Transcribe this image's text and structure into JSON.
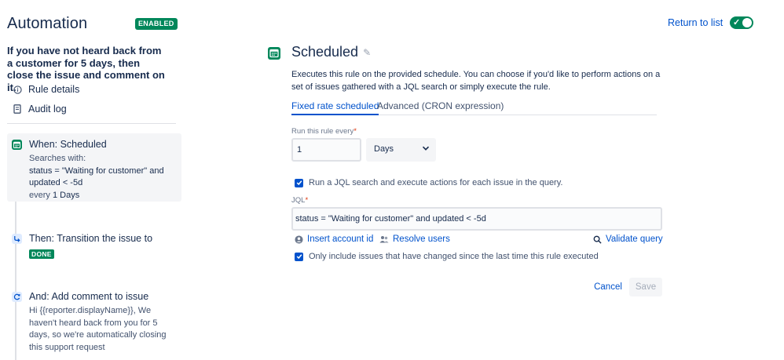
{
  "header": {
    "title": "Automation",
    "status_badge": "ENABLED",
    "return_link": "Return to list",
    "toggle_on": true,
    "toggle_color": "#00875a"
  },
  "sidebar": {
    "rule_description": "If you have not heard back from a customer for 5 days, then close the issue and comment on it.",
    "links": [
      {
        "label": "Rule details",
        "icon": "info-icon"
      },
      {
        "label": "Audit log",
        "icon": "document-icon"
      }
    ],
    "steps": [
      {
        "icon": "calendar-icon",
        "title": "When: Scheduled",
        "line1": "Searches with:",
        "query": "status = \"Waiting for customer\" and updated < -5d",
        "every_prefix": "every",
        "every_value": "1 Days"
      },
      {
        "icon": "transition-icon",
        "title": "Then: Transition the issue to",
        "badge": "DONE"
      },
      {
        "icon": "comment-action-icon",
        "title": "And: Add comment to issue",
        "body": "Hi {{reporter.displayName}}, We haven't heard back from you for 5 days, so we're automatically closing this support request"
      }
    ]
  },
  "main": {
    "title": "Scheduled",
    "description": "Executes this rule on the provided schedule. You can choose if you'd like to perform actions on a set of issues gathered with a JQL search or simply execute the rule.",
    "tabs": [
      {
        "label": "Fixed rate scheduled",
        "active": true
      },
      {
        "label": "Advanced (CRON expression)",
        "active": false
      }
    ],
    "interval": {
      "label": "Run this rule every",
      "required_mark": "*",
      "value": "1",
      "unit": "Days"
    },
    "jql_checkbox": {
      "label": "Run a JQL search and execute actions for each issue in the query.",
      "checked": true
    },
    "jql": {
      "label": "JQL",
      "required_mark": "*",
      "value": "status = \"Waiting for customer\" and updated < -5d"
    },
    "links": {
      "insert_account": "Insert account id",
      "resolve_users": "Resolve users",
      "validate_query": "Validate query"
    },
    "changed_checkbox": {
      "label": "Only include issues that have changed since the last time this rule executed",
      "checked": true
    },
    "buttons": {
      "cancel": "Cancel",
      "save": "Save"
    },
    "accent_color": "#0052cc"
  }
}
